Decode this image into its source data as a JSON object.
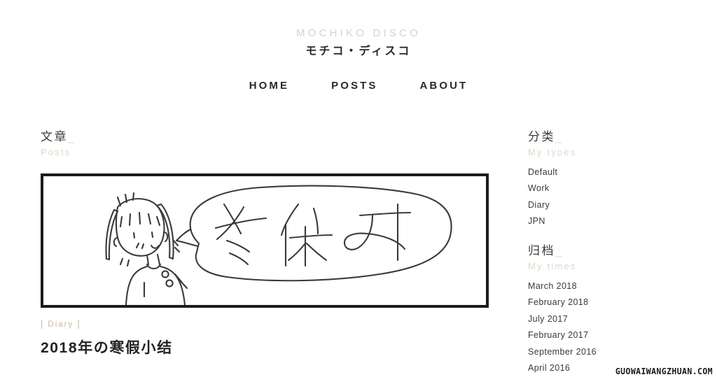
{
  "header": {
    "site_title_en": "MOCHIKO DISCO",
    "site_title_jp": "モチコ・ディスコ",
    "nav": [
      {
        "label": "HOME"
      },
      {
        "label": "POSTS"
      },
      {
        "label": "ABOUT"
      }
    ]
  },
  "main": {
    "section_heading_cn": "文章",
    "section_heading_underscore": "_",
    "section_heading_en": "Posts",
    "post": {
      "tag": "[ Diary ]",
      "title": "2018年の寒假小结",
      "illustration_alt": "冬休み",
      "illustration_text": "冬休み"
    }
  },
  "sidebar": {
    "blocks": [
      {
        "heading_cn": "分类",
        "heading_underscore": "_",
        "heading_en": "My types",
        "items": [
          {
            "label": "Default"
          },
          {
            "label": "Work"
          },
          {
            "label": "Diary"
          },
          {
            "label": "JPN"
          }
        ]
      },
      {
        "heading_cn": "归档",
        "heading_underscore": "_",
        "heading_en": "My times",
        "items": [
          {
            "label": "March 2018"
          },
          {
            "label": "February 2018"
          },
          {
            "label": "July 2017"
          },
          {
            "label": "February 2017"
          },
          {
            "label": "September 2016"
          },
          {
            "label": "April 2016"
          }
        ]
      }
    ]
  },
  "watermark": {
    "text": "GUOWAIWANGZHUAN.COM"
  },
  "colors": {
    "accent_beige": "#ddd8ca",
    "tag_gold": "#c9b98f",
    "text_dark": "#2b2b2b",
    "frame_black": "#1c1c1c",
    "background": "#ffffff"
  }
}
